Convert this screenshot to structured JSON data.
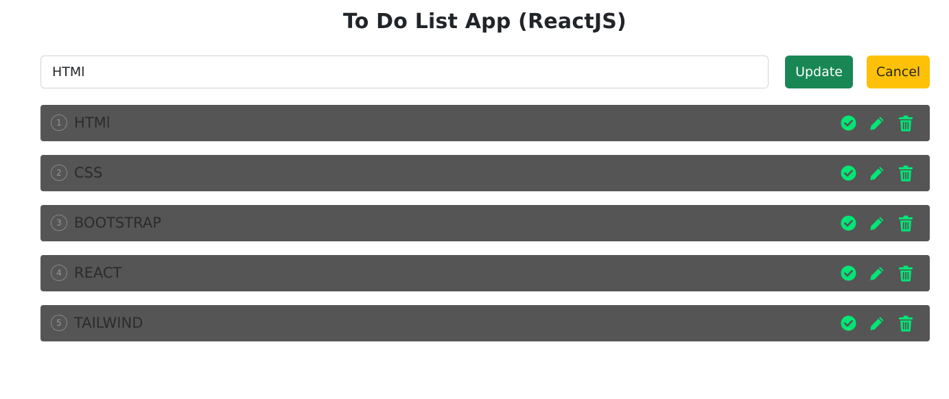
{
  "title": "To Do List App (ReactJS)",
  "edit": {
    "value": "HTMl",
    "update_label": "Update",
    "cancel_label": "Cancel"
  },
  "colors": {
    "accent": "#00e676",
    "item_bg": "#555555",
    "update_bg": "#198754",
    "cancel_bg": "#ffc107"
  },
  "todos": [
    {
      "num": "1",
      "text": "HTMl",
      "icons": [
        "check-circle-icon",
        "pencil-icon",
        "trash-icon"
      ]
    },
    {
      "num": "2",
      "text": "CSS",
      "icons": [
        "check-circle-icon",
        "pencil-icon",
        "trash-icon"
      ]
    },
    {
      "num": "3",
      "text": "BOOTSTRAP",
      "icons": [
        "check-circle-icon",
        "pencil-icon",
        "trash-icon"
      ]
    },
    {
      "num": "4",
      "text": "REACT",
      "icons": [
        "check-circle-icon",
        "pencil-icon",
        "trash-icon"
      ]
    },
    {
      "num": "5",
      "text": "TAILWIND",
      "icons": [
        "check-circle-icon",
        "pencil-icon",
        "trash-icon"
      ]
    }
  ]
}
